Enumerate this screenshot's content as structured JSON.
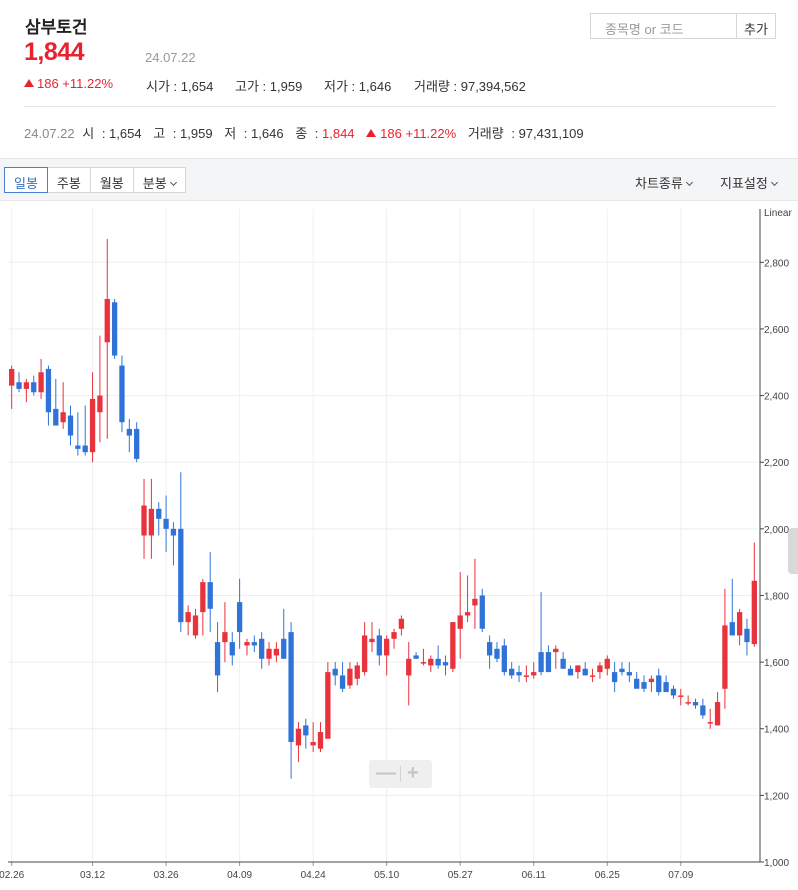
{
  "header": {
    "name": "삼부토건",
    "price": "1,844",
    "date": "24.07.22",
    "change": "186 +11.22%",
    "search_placeholder": "종목명 or 코드",
    "add_label": "추가"
  },
  "stats": [
    {
      "label": "시가",
      "value": "1,654"
    },
    {
      "label": "고가",
      "value": "1,959"
    },
    {
      "label": "저가",
      "value": "1,646"
    },
    {
      "label": "거래량",
      "value": "97,394,562"
    }
  ],
  "summary": {
    "date": "24.07.22",
    "open_label": "시",
    "open": "1,654",
    "high_label": "고",
    "high": "1,959",
    "low_label": "저",
    "low": "1,646",
    "close_label": "종",
    "close": "1,844",
    "change": "186 +11.22%",
    "volume_label": "거래량",
    "volume": "97,431,109"
  },
  "toolbar": {
    "tabs": [
      "일봉",
      "주봉",
      "월봉",
      "분봉"
    ],
    "active_tab": 0,
    "chart_type_label": "차트종류",
    "indicator_label": "지표설정"
  },
  "colors": {
    "up": "#e8323c",
    "down": "#2f73d9",
    "price_red": "#e8232e"
  },
  "chart_data": {
    "type": "candlestick",
    "scale_label": "Linear",
    "ylim": [
      1000,
      2960
    ],
    "y_ticks": [
      1000,
      1200,
      1400,
      1600,
      1800,
      2000,
      2200,
      2400,
      2600,
      2800
    ],
    "y_tick_labels": [
      "1,000",
      "1,200",
      "1,400",
      "1,600",
      "1,800",
      "2,000",
      "2,200",
      "2,400",
      "2,600",
      "2,800"
    ],
    "x_ticks": [
      {
        "index": 0,
        "label": "02.26"
      },
      {
        "index": 11,
        "label": "03.12"
      },
      {
        "index": 21,
        "label": "03.26"
      },
      {
        "index": 31,
        "label": "04.09"
      },
      {
        "index": 41,
        "label": "04.24"
      },
      {
        "index": 51,
        "label": "05.10"
      },
      {
        "index": 61,
        "label": "05.27"
      },
      {
        "index": 71,
        "label": "06.11"
      },
      {
        "index": 81,
        "label": "06.25"
      },
      {
        "index": 91,
        "label": "07.09"
      }
    ],
    "candles": [
      [
        2430,
        2490,
        2360,
        2480
      ],
      [
        2440,
        2470,
        2410,
        2420
      ],
      [
        2420,
        2450,
        2380,
        2440
      ],
      [
        2440,
        2460,
        2400,
        2410
      ],
      [
        2410,
        2510,
        2390,
        2470
      ],
      [
        2480,
        2490,
        2310,
        2350
      ],
      [
        2360,
        2450,
        2330,
        2310
      ],
      [
        2320,
        2440,
        2300,
        2350
      ],
      [
        2340,
        2370,
        2250,
        2280
      ],
      [
        2250,
        2350,
        2220,
        2240
      ],
      [
        2250,
        2370,
        2220,
        2230
      ],
      [
        2230,
        2470,
        2200,
        2390
      ],
      [
        2350,
        2580,
        2260,
        2400
      ],
      [
        2560,
        2870,
        2270,
        2690
      ],
      [
        2680,
        2690,
        2510,
        2520
      ],
      [
        2490,
        2520,
        2290,
        2320
      ],
      [
        2300,
        2330,
        2230,
        2280
      ],
      [
        2300,
        2320,
        2200,
        2210
      ],
      [
        1980,
        2150,
        1910,
        2070
      ],
      [
        1980,
        2150,
        1910,
        2060
      ],
      [
        2060,
        2080,
        1980,
        2030
      ],
      [
        2030,
        2100,
        1930,
        2000
      ],
      [
        2000,
        2020,
        1890,
        1980
      ],
      [
        2000,
        2170,
        1690,
        1720
      ],
      [
        1720,
        1770,
        1680,
        1750
      ],
      [
        1680,
        1760,
        1670,
        1740
      ],
      [
        1750,
        1850,
        1680,
        1840
      ],
      [
        1840,
        1930,
        1690,
        1760
      ],
      [
        1660,
        1720,
        1510,
        1560
      ],
      [
        1660,
        1780,
        1600,
        1690
      ],
      [
        1660,
        1690,
        1590,
        1620
      ],
      [
        1780,
        1850,
        1640,
        1690
      ],
      [
        1650,
        1670,
        1620,
        1660
      ],
      [
        1660,
        1680,
        1630,
        1650
      ],
      [
        1670,
        1690,
        1580,
        1610
      ],
      [
        1610,
        1660,
        1590,
        1640
      ],
      [
        1620,
        1660,
        1600,
        1640
      ],
      [
        1670,
        1760,
        1620,
        1610
      ],
      [
        1690,
        1720,
        1250,
        1360
      ],
      [
        1350,
        1420,
        1300,
        1400
      ],
      [
        1410,
        1430,
        1340,
        1380
      ],
      [
        1350,
        1420,
        1330,
        1360
      ],
      [
        1340,
        1420,
        1330,
        1390
      ],
      [
        1370,
        1600,
        1370,
        1570
      ],
      [
        1580,
        1600,
        1530,
        1560
      ],
      [
        1560,
        1600,
        1510,
        1520
      ],
      [
        1530,
        1600,
        1520,
        1580
      ],
      [
        1550,
        1600,
        1530,
        1590
      ],
      [
        1570,
        1720,
        1560,
        1680
      ],
      [
        1660,
        1720,
        1630,
        1670
      ],
      [
        1680,
        1700,
        1590,
        1620
      ],
      [
        1620,
        1680,
        1560,
        1670
      ],
      [
        1670,
        1700,
        1640,
        1690
      ],
      [
        1700,
        1740,
        1680,
        1730
      ],
      [
        1560,
        1660,
        1470,
        1610
      ],
      [
        1620,
        1630,
        1610,
        1610
      ],
      [
        1600,
        1640,
        1590,
        1600
      ],
      [
        1590,
        1620,
        1570,
        1610
      ],
      [
        1610,
        1650,
        1580,
        1590
      ],
      [
        1600,
        1620,
        1560,
        1590
      ],
      [
        1580,
        1670,
        1570,
        1720
      ],
      [
        1700,
        1870,
        1610,
        1740
      ],
      [
        1740,
        1860,
        1720,
        1750
      ],
      [
        1770,
        1910,
        1700,
        1790
      ],
      [
        1800,
        1820,
        1690,
        1700
      ],
      [
        1660,
        1680,
        1580,
        1620
      ],
      [
        1640,
        1660,
        1600,
        1610
      ],
      [
        1650,
        1670,
        1560,
        1570
      ],
      [
        1580,
        1600,
        1550,
        1560
      ],
      [
        1570,
        1590,
        1540,
        1560
      ],
      [
        1560,
        1590,
        1540,
        1560
      ],
      [
        1560,
        1600,
        1550,
        1570
      ],
      [
        1630,
        1810,
        1560,
        1570
      ],
      [
        1630,
        1650,
        1590,
        1570
      ],
      [
        1630,
        1650,
        1580,
        1640
      ],
      [
        1610,
        1630,
        1580,
        1580
      ],
      [
        1580,
        1590,
        1560,
        1560
      ],
      [
        1570,
        1590,
        1550,
        1590
      ],
      [
        1580,
        1600,
        1570,
        1560
      ],
      [
        1560,
        1580,
        1540,
        1560
      ],
      [
        1570,
        1600,
        1550,
        1590
      ],
      [
        1580,
        1620,
        1560,
        1610
      ],
      [
        1570,
        1600,
        1510,
        1540
      ],
      [
        1580,
        1600,
        1560,
        1570
      ],
      [
        1570,
        1600,
        1540,
        1560
      ],
      [
        1550,
        1570,
        1530,
        1520
      ],
      [
        1540,
        1560,
        1510,
        1520
      ],
      [
        1540,
        1560,
        1510,
        1550
      ],
      [
        1560,
        1580,
        1500,
        1510
      ],
      [
        1540,
        1560,
        1510,
        1510
      ],
      [
        1520,
        1530,
        1490,
        1500
      ],
      [
        1500,
        1520,
        1470,
        1500
      ],
      [
        1480,
        1500,
        1470,
        1480
      ],
      [
        1480,
        1490,
        1460,
        1470
      ],
      [
        1470,
        1490,
        1430,
        1440
      ],
      [
        1420,
        1460,
        1400,
        1420
      ],
      [
        1410,
        1510,
        1410,
        1480
      ],
      [
        1520,
        1820,
        1460,
        1710
      ],
      [
        1720,
        1850,
        1680,
        1680
      ],
      [
        1680,
        1760,
        1650,
        1750
      ],
      [
        1700,
        1730,
        1620,
        1660
      ],
      [
        1654,
        1959,
        1646,
        1844
      ]
    ]
  }
}
